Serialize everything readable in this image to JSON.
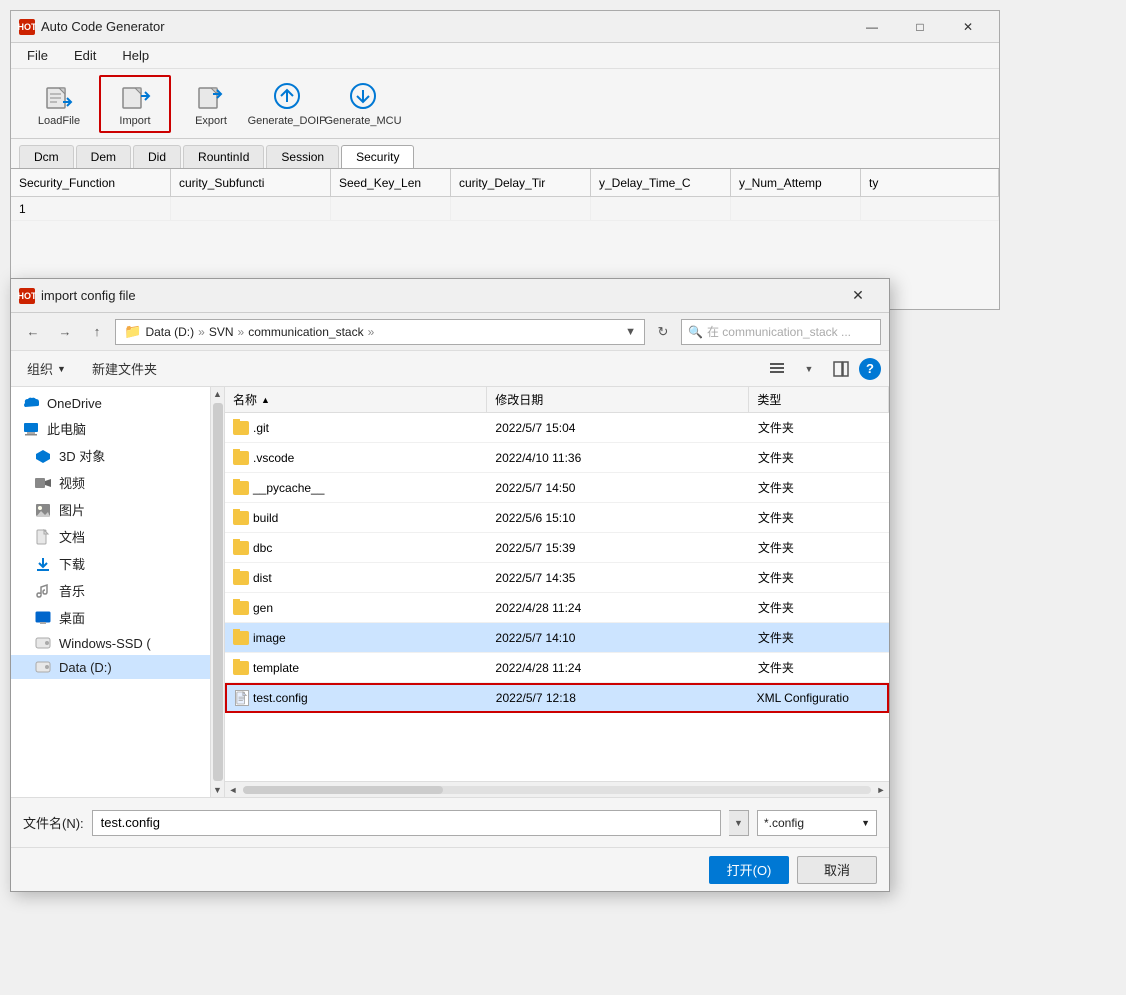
{
  "app": {
    "title": "Auto Code Generator",
    "icon_text": "HOT",
    "menu": {
      "items": [
        "File",
        "Edit",
        "Help"
      ]
    },
    "toolbar": {
      "buttons": [
        {
          "id": "loadfile",
          "label": "LoadFile",
          "icon": "load"
        },
        {
          "id": "import",
          "label": "Import",
          "icon": "import",
          "highlighted": true
        },
        {
          "id": "export",
          "label": "Export",
          "icon": "export"
        },
        {
          "id": "generate_doip",
          "label": "Generate_DOIP",
          "icon": "gen-doip"
        },
        {
          "id": "generate_mcu",
          "label": "Generate_MCU",
          "icon": "gen-mcu"
        }
      ]
    },
    "tabs": {
      "items": [
        "Dcm",
        "Dem",
        "Did",
        "RountinId",
        "Session",
        "Security"
      ],
      "active": "Security"
    },
    "table": {
      "columns": [
        "Security_Function",
        "curity_Subfuncti",
        "Seed_Key_Len",
        "curity_Delay_Tir",
        "y_Delay_Time_C",
        "y_Num_Attemp",
        "ty"
      ],
      "rows": [
        {
          "col1": "1",
          "col2": "",
          "col3": "",
          "col4": "",
          "col5": "",
          "col6": "",
          "col7": ""
        }
      ]
    }
  },
  "dialog": {
    "title": "import config file",
    "icon_text": "HOT",
    "nav": {
      "back_disabled": false,
      "forward_disabled": false,
      "up_disabled": false,
      "breadcrumbs": [
        "Data (D:)",
        "SVN",
        "communication_stack"
      ],
      "search_placeholder": "在 communication_stack ..."
    },
    "toolbar": {
      "organize_label": "组织",
      "new_folder_label": "新建文件夹"
    },
    "sidebar": {
      "items": [
        {
          "id": "onedrive",
          "label": "OneDrive",
          "icon": "cloud"
        },
        {
          "id": "this-pc",
          "label": "此电脑",
          "icon": "computer"
        },
        {
          "id": "3d-objects",
          "label": "3D 对象",
          "icon": "3d"
        },
        {
          "id": "video",
          "label": "视频",
          "icon": "video"
        },
        {
          "id": "pictures",
          "label": "图片",
          "icon": "picture"
        },
        {
          "id": "documents",
          "label": "文档",
          "icon": "doc"
        },
        {
          "id": "download",
          "label": "下载",
          "icon": "download"
        },
        {
          "id": "music",
          "label": "音乐",
          "icon": "music"
        },
        {
          "id": "desktop",
          "label": "桌面",
          "icon": "desktop"
        },
        {
          "id": "windows-ssd",
          "label": "Windows-SSD (",
          "icon": "drive"
        },
        {
          "id": "data-d",
          "label": "Data (D:)",
          "icon": "drive",
          "selected": true
        }
      ]
    },
    "file_list": {
      "columns": [
        {
          "id": "name",
          "label": "名称",
          "sort": "asc"
        },
        {
          "id": "date",
          "label": "修改日期"
        },
        {
          "id": "type",
          "label": "类型"
        }
      ],
      "rows": [
        {
          "name": ".git",
          "date": "2022/5/7 15:04",
          "type": "文件夹",
          "icon": "folder"
        },
        {
          "name": ".vscode",
          "date": "2022/4/10 11:36",
          "type": "文件夹",
          "icon": "folder"
        },
        {
          "name": "__pycache__",
          "date": "2022/5/7 14:50",
          "type": "文件夹",
          "icon": "folder"
        },
        {
          "name": "build",
          "date": "2022/5/6 15:10",
          "type": "文件夹",
          "icon": "folder"
        },
        {
          "name": "dbc",
          "date": "2022/5/7 15:39",
          "type": "文件夹",
          "icon": "folder"
        },
        {
          "name": "dist",
          "date": "2022/5/7 14:35",
          "type": "文件夹",
          "icon": "folder"
        },
        {
          "name": "gen",
          "date": "2022/4/28 11:24",
          "type": "文件夹",
          "icon": "folder"
        },
        {
          "name": "image",
          "date": "2022/5/7 14:10",
          "type": "文件夹",
          "icon": "folder",
          "selected": true
        },
        {
          "name": "template",
          "date": "2022/4/28 11:24",
          "type": "文件夹",
          "icon": "folder"
        },
        {
          "name": "test.config",
          "date": "2022/5/7 12:18",
          "type": "XML Configuratio",
          "icon": "file",
          "highlighted": true
        }
      ]
    },
    "bottom": {
      "filename_label": "文件名(N):",
      "filename_value": "test.config",
      "filetype_value": "*.config"
    },
    "actions": {
      "open_label": "打开(O)",
      "cancel_label": "取消"
    }
  }
}
